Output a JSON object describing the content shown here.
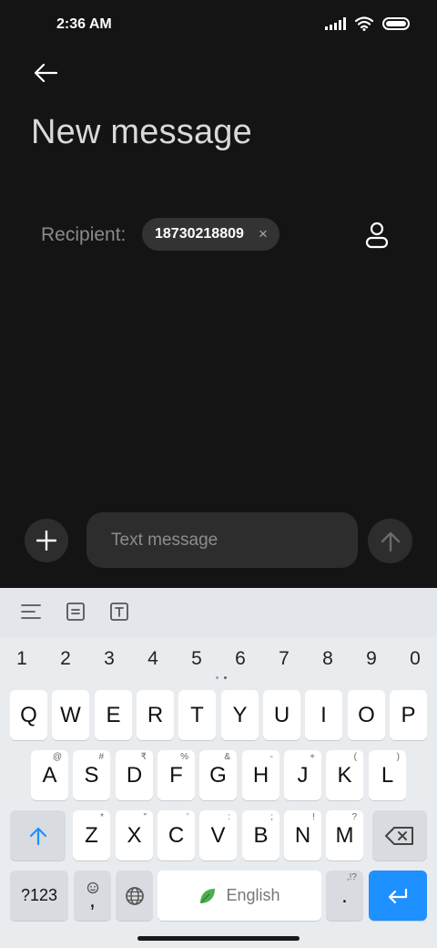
{
  "status": {
    "time": "2:36 AM"
  },
  "header": {
    "title": "New message"
  },
  "recipient": {
    "label": "Recipient:",
    "chip": "18730218809",
    "chip_remove": "×"
  },
  "compose": {
    "placeholder": "Text message"
  },
  "keyboard": {
    "numbers": [
      "1",
      "2",
      "3",
      "4",
      "5",
      "6",
      "7",
      "8",
      "9",
      "0"
    ],
    "row1": [
      {
        "key": "Q",
        "hint": ""
      },
      {
        "key": "W",
        "hint": ""
      },
      {
        "key": "E",
        "hint": ""
      },
      {
        "key": "R",
        "hint": ""
      },
      {
        "key": "T",
        "hint": ""
      },
      {
        "key": "Y",
        "hint": ""
      },
      {
        "key": "U",
        "hint": ""
      },
      {
        "key": "I",
        "hint": ""
      },
      {
        "key": "O",
        "hint": ""
      },
      {
        "key": "P",
        "hint": ""
      }
    ],
    "row2": [
      {
        "key": "A",
        "hint": "@"
      },
      {
        "key": "S",
        "hint": "#"
      },
      {
        "key": "D",
        "hint": "₹"
      },
      {
        "key": "F",
        "hint": "%"
      },
      {
        "key": "G",
        "hint": "&"
      },
      {
        "key": "H",
        "hint": "-"
      },
      {
        "key": "J",
        "hint": "+"
      },
      {
        "key": "K",
        "hint": "("
      },
      {
        "key": "L",
        "hint": ")"
      }
    ],
    "row3": [
      {
        "key": "Z",
        "hint": "*"
      },
      {
        "key": "X",
        "hint": "\""
      },
      {
        "key": "C",
        "hint": "'"
      },
      {
        "key": "V",
        "hint": ":"
      },
      {
        "key": "B",
        "hint": ";"
      },
      {
        "key": "N",
        "hint": "!"
      },
      {
        "key": "M",
        "hint": "?"
      }
    ],
    "symbols_key": "?123",
    "comma_key": ",",
    "space_label": "English",
    "period_key": ".",
    "period_hint": ",!?"
  },
  "colors": {
    "background": "#141414",
    "accent": "#1e90ff",
    "leaf": "#4caf50"
  }
}
